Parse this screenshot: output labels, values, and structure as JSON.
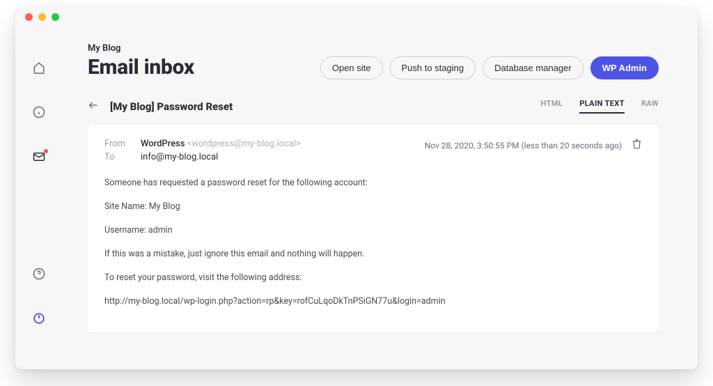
{
  "window": {
    "traffic_lights": [
      "close",
      "minimize",
      "maximize"
    ]
  },
  "sidebar": {
    "items": [
      {
        "name": "home-icon"
      },
      {
        "name": "info-icon"
      },
      {
        "name": "mail-icon",
        "active": true,
        "badge": true
      },
      {
        "name": "help-icon",
        "bottom": true
      },
      {
        "name": "power-icon",
        "bottom": true
      }
    ]
  },
  "header": {
    "site_name": "My Blog",
    "page_title": "Email inbox",
    "actions": {
      "open_site": "Open site",
      "push_staging": "Push to staging",
      "db_manager": "Database manager",
      "wp_admin": "WP Admin"
    }
  },
  "message": {
    "subject": "[My Blog] Password Reset",
    "tabs": {
      "html": "HTML",
      "plain_text": "PLAIN TEXT",
      "raw": "RAW",
      "active": "plain_text"
    },
    "meta": {
      "from_label": "From",
      "from_name": "WordPress",
      "from_email": "<wordpress@my-blog.local>",
      "to_label": "To",
      "to_value": "info@my-blog.local",
      "timestamp": "Nov 28, 2020, 3:50:55 PM (less than 20 seconds ago)"
    },
    "body": {
      "p1": "Someone has requested a password reset for the following account:",
      "p2": "Site Name: My Blog",
      "p3": "Username: admin",
      "p4": "If this was a mistake, just ignore this email and nothing will happen.",
      "p5": "To reset your password, visit the following address:",
      "p6": "http://my-blog.local/wp-login.php?action=rp&key=rofCuLqoDkTnPSiGN77u&login=admin"
    }
  }
}
